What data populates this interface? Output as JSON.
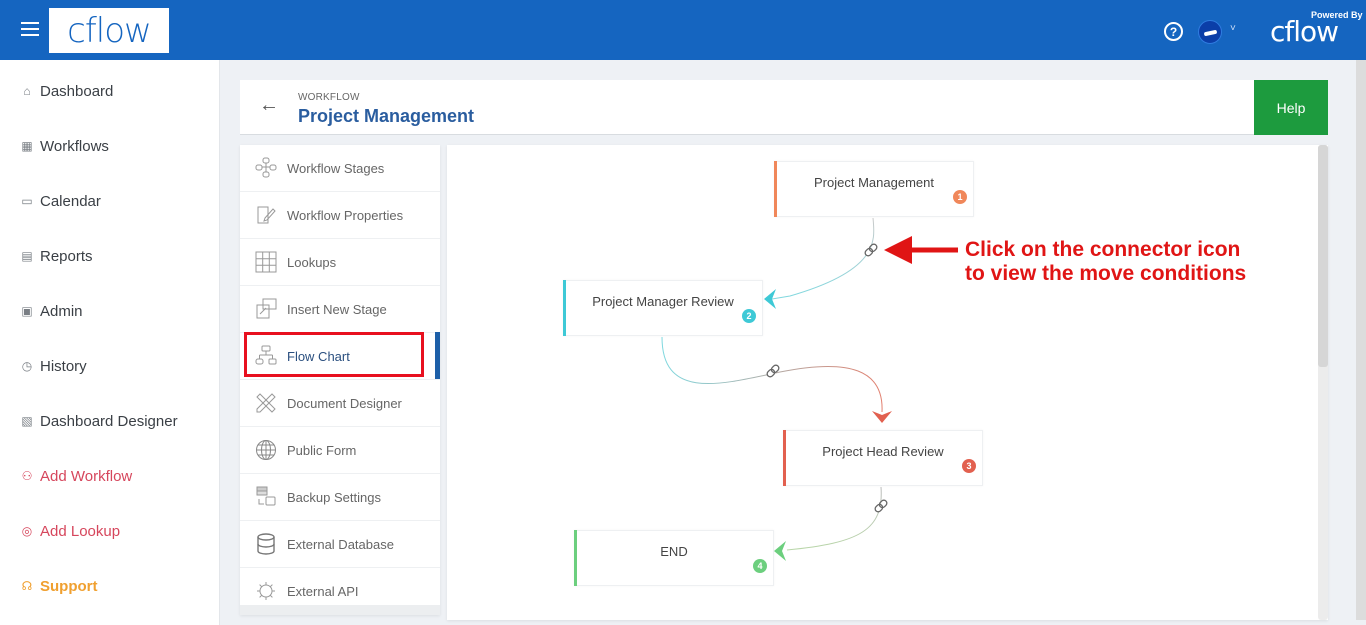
{
  "topbar": {
    "logo_text": "cflow",
    "help_icon": "question-circle-icon",
    "user_caret": "˅",
    "powered_by": "Powered By",
    "powered_logo": "cflow"
  },
  "sidebar": {
    "items": [
      {
        "label": "Dashboard",
        "icon": "home-icon",
        "glyph": "⌂"
      },
      {
        "label": "Workflows",
        "icon": "grid-icon",
        "glyph": "▦"
      },
      {
        "label": "Calendar",
        "icon": "calendar-icon",
        "glyph": "▭"
      },
      {
        "label": "Reports",
        "icon": "reports-icon",
        "glyph": "▤"
      },
      {
        "label": "Admin",
        "icon": "admin-icon",
        "glyph": "▣"
      },
      {
        "label": "History",
        "icon": "history-icon",
        "glyph": "◷"
      },
      {
        "label": "Dashboard Designer",
        "icon": "dashboard-designer-icon",
        "glyph": "▧"
      },
      {
        "label": "Add Workflow",
        "icon": "add-workflow-icon",
        "glyph": "⚇"
      },
      {
        "label": "Add Lookup",
        "icon": "add-lookup-icon",
        "glyph": "◎"
      },
      {
        "label": "Support",
        "icon": "headset-icon",
        "glyph": "☊"
      }
    ],
    "colors": {
      "default": "#3a3f45",
      "add": "#d6465c",
      "support": "#f0a030"
    }
  },
  "header": {
    "breadcrumb": "WORKFLOW",
    "title": "Project Management",
    "back_icon": "←",
    "help_label": "Help"
  },
  "menu": {
    "items": [
      {
        "label": "Workflow Stages",
        "icon": "workflow-stages-icon"
      },
      {
        "label": "Workflow Properties",
        "icon": "workflow-properties-icon"
      },
      {
        "label": "Lookups",
        "icon": "lookups-icon"
      },
      {
        "label": "Insert New Stage",
        "icon": "insert-stage-icon"
      },
      {
        "label": "Flow Chart",
        "icon": "flow-chart-icon",
        "active": true
      },
      {
        "label": "Document Designer",
        "icon": "document-designer-icon"
      },
      {
        "label": "Public Form",
        "icon": "globe-icon"
      },
      {
        "label": "Backup Settings",
        "icon": "backup-icon"
      },
      {
        "label": "External Database",
        "icon": "database-icon"
      },
      {
        "label": "External API",
        "icon": "api-gear-icon"
      }
    ]
  },
  "flowchart": {
    "nodes": [
      {
        "label": "Project Management",
        "number": "1",
        "color": "#f0875a"
      },
      {
        "label": "Project Manager Review",
        "number": "2",
        "color": "#3ec9d6"
      },
      {
        "label": "Project Head Review",
        "number": "3",
        "color": "#e2604f"
      },
      {
        "label": "END",
        "number": "4",
        "color": "#6ccf7e"
      }
    ]
  },
  "annotation": {
    "line1": "Click on the connector icon",
    "line2": "to view the move conditions",
    "color": "#e01515"
  }
}
